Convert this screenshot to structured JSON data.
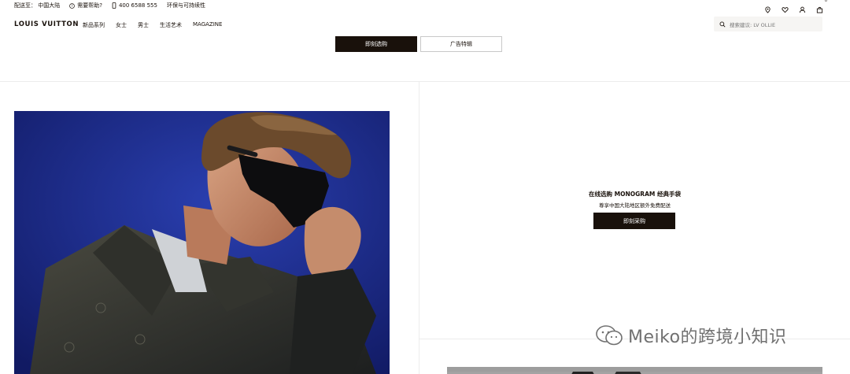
{
  "utility": {
    "ship_to": "配送至： 中国大陆",
    "need_help": "需要帮助?",
    "phone": "400 6588 555",
    "sustainability": "环保与可持续性",
    "bag_count": "0"
  },
  "nav": {
    "logo": "LOUIS VUITTON",
    "links": [
      "新品系列",
      "女士",
      "男士",
      "生活艺术",
      "MAGAZINE"
    ],
    "search_placeholder": "搜索建议: LV OLLIE"
  },
  "top_buttons": {
    "primary": "即刻选购",
    "secondary": "广告特辑"
  },
  "promo": {
    "title": "在线选购 MONOGRAM 经典手袋",
    "subtitle": "尊享中国大陆地区额外免费配送",
    "button": "即刻采购"
  },
  "watermark": "Meiko的跨境小知识",
  "colors": {
    "brand_dark": "#19110b",
    "hero_background": "#16237a"
  }
}
